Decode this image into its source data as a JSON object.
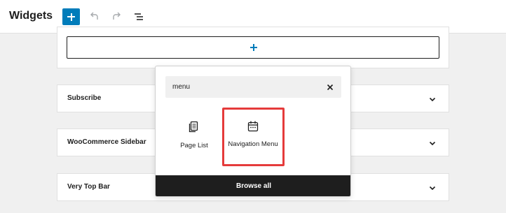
{
  "header": {
    "title": "Widgets",
    "icons": [
      "plus-icon",
      "undo-icon",
      "redo-icon",
      "list-view-icon"
    ]
  },
  "widget_areas": [
    {
      "label": "Subscribe"
    },
    {
      "label": "WooCommerce Sidebar"
    },
    {
      "label": "Very Top Bar"
    }
  ],
  "inserter": {
    "search_value": "menu",
    "results": [
      {
        "label": "Page List",
        "icon": "page-list-icon"
      },
      {
        "label": "Navigation Menu",
        "icon": "navigation-icon",
        "highlighted": true
      }
    ],
    "browse_all_label": "Browse all"
  },
  "colors": {
    "accent": "#007cba",
    "highlight": "#e53b3b",
    "dark": "#1e1e1e"
  }
}
